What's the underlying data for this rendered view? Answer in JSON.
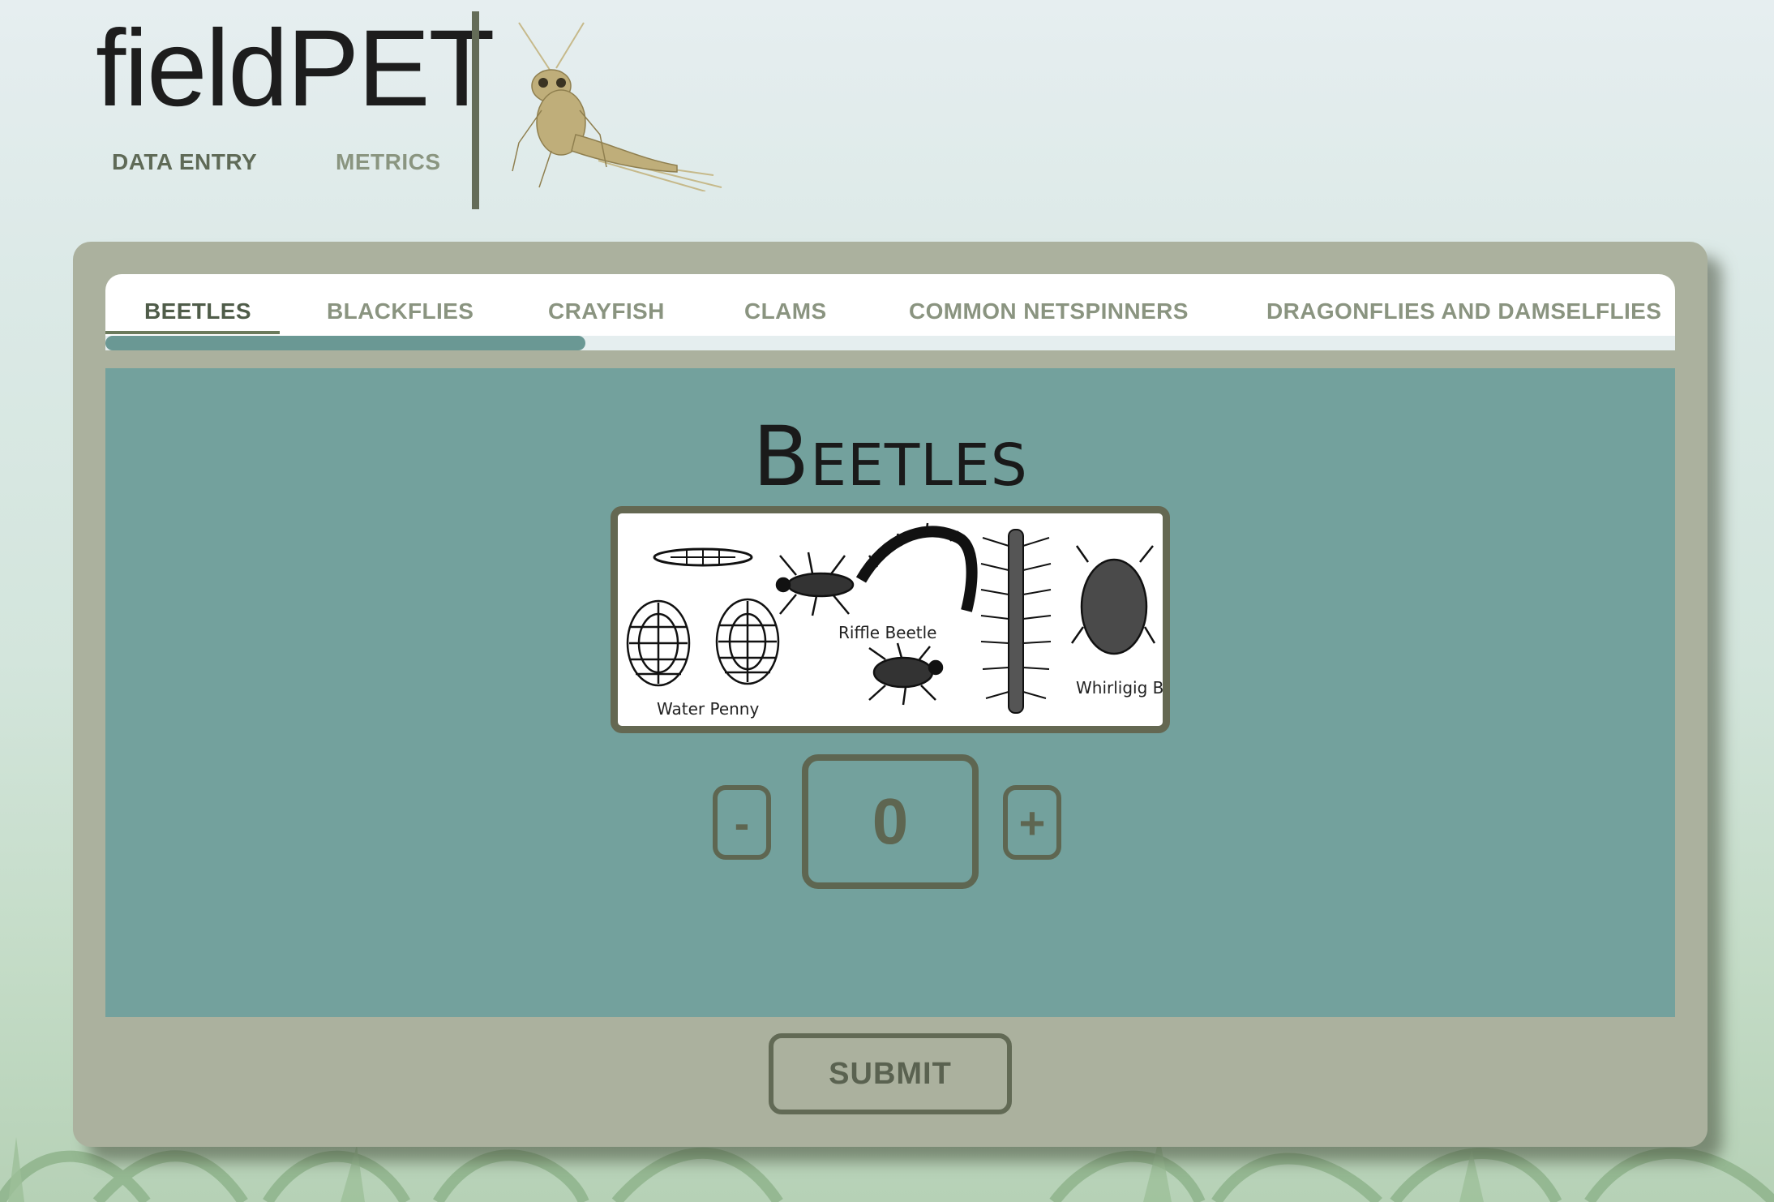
{
  "header": {
    "brand": "fieldPET",
    "nav": {
      "data_entry": "DATA ENTRY",
      "metrics": "METRICS"
    }
  },
  "tabs": [
    {
      "label": "BEETLES",
      "active": true
    },
    {
      "label": "BLACKFLIES",
      "active": false
    },
    {
      "label": "CRAYFISH",
      "active": false
    },
    {
      "label": "CLAMS",
      "active": false
    },
    {
      "label": "COMMON NETSPINNERS",
      "active": false
    },
    {
      "label": "DRAGONFLIES AND DAMSELFLIES",
      "active": false
    }
  ],
  "panel": {
    "title": "Beetles",
    "illustration_labels": {
      "water_penny": "Water Penny",
      "riffle_beetle": "Riffle Beetle",
      "whirligig_beetle": "Whirligig Beetle"
    },
    "counter": {
      "value": "0",
      "minus_label": "-",
      "plus_label": "+"
    }
  },
  "submit_label": "SUBMIT",
  "colors": {
    "card": "#abb19e",
    "panel": "#73a19d",
    "control_border": "#5e6651",
    "scroll_thumb": "#6a9894"
  }
}
